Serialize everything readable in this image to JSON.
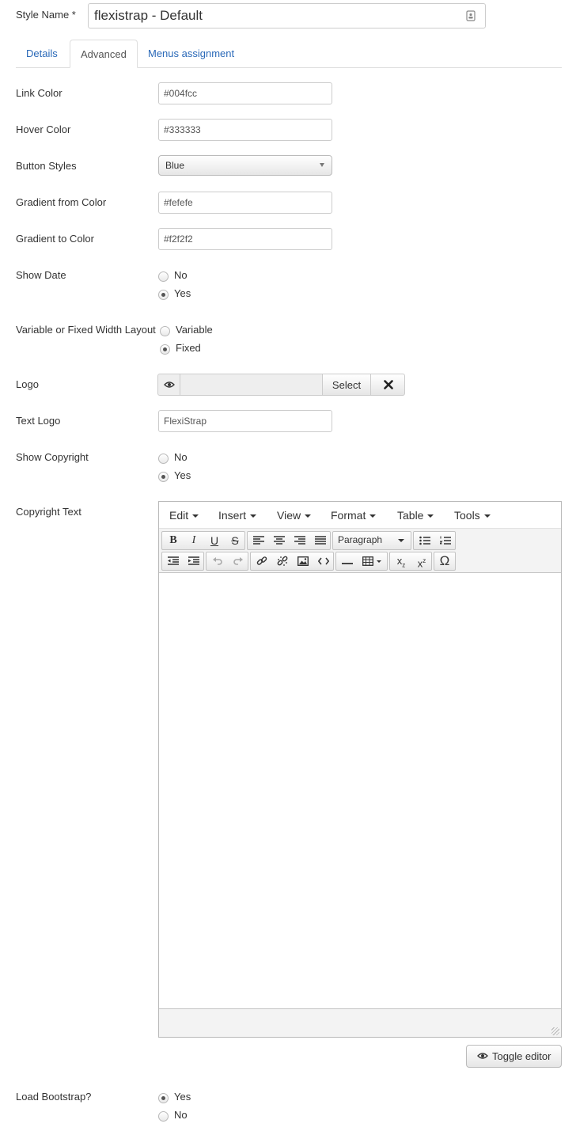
{
  "style_name": {
    "label": "Style Name *",
    "value": "flexistrap - Default"
  },
  "tabs": [
    {
      "label": "Details",
      "active": false
    },
    {
      "label": "Advanced",
      "active": true
    },
    {
      "label": "Menus assignment",
      "active": false
    }
  ],
  "fields": {
    "link_color": {
      "label": "Link Color",
      "value": "#004fcc"
    },
    "hover_color": {
      "label": "Hover Color",
      "value": "#333333"
    },
    "button_styles": {
      "label": "Button Styles",
      "value": "Blue"
    },
    "gradient_from": {
      "label": "Gradient from Color",
      "value": "#fefefe"
    },
    "gradient_to": {
      "label": "Gradient to Color",
      "value": "#f2f2f2"
    },
    "show_date": {
      "label": "Show Date",
      "options": [
        "No",
        "Yes"
      ],
      "selected": "Yes"
    },
    "layout": {
      "label": "Variable or Fixed Width Layout",
      "options": [
        "Variable",
        "Fixed"
      ],
      "selected": "Fixed"
    },
    "logo": {
      "label": "Logo",
      "select_label": "Select",
      "value": ""
    },
    "text_logo": {
      "label": "Text Logo",
      "value": "FlexiStrap"
    },
    "show_copyright": {
      "label": "Show Copyright",
      "options": [
        "No",
        "Yes"
      ],
      "selected": "Yes"
    },
    "copyright_text": {
      "label": "Copyright Text"
    },
    "load_bootstrap": {
      "label": "Load Bootstrap?",
      "options": [
        "Yes",
        "No"
      ],
      "selected": "Yes"
    }
  },
  "editor": {
    "menus": [
      "Edit",
      "Insert",
      "View",
      "Format",
      "Table",
      "Tools"
    ],
    "block_format": "Paragraph",
    "content": ""
  },
  "toggle_editor": {
    "label": "Toggle editor"
  },
  "icons": [
    "contact-card-icon",
    "eye-icon",
    "close-icon",
    "bold-icon",
    "italic-icon",
    "underline-icon",
    "strikethrough-icon",
    "align-left-icon",
    "align-center-icon",
    "align-right-icon",
    "align-justify-icon",
    "bullet-list-icon",
    "numbered-list-icon",
    "outdent-icon",
    "indent-icon",
    "undo-icon",
    "redo-icon",
    "link-icon",
    "unlink-icon",
    "image-icon",
    "code-icon",
    "horizontal-rule-icon",
    "table-icon",
    "subscript-icon",
    "superscript-icon",
    "special-character-icon"
  ]
}
